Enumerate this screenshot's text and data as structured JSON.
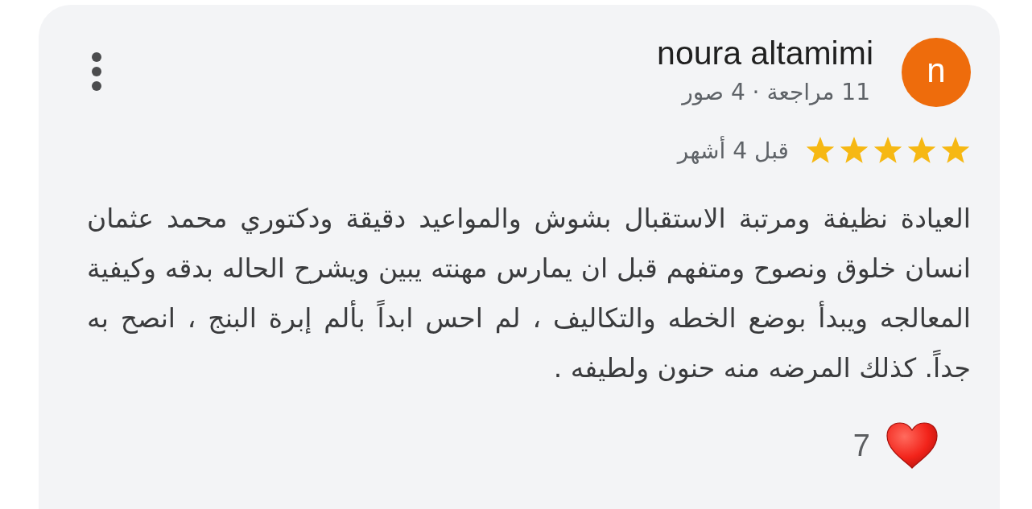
{
  "review": {
    "author": {
      "name": "noura altamimi",
      "initial": "n"
    },
    "meta": "11 مراجعة · 4 صور",
    "stars": 5,
    "time": "قبل 4 أشهر",
    "text": "العيادة نظيفة ومرتبة الاستقبال بشوش والمواعيد دقيقة ودكتوري محمد عثمان انسان خلوق ونصوح ومتفهم قبل ان يمارس مهنته يبين ويشرح الحاله بدقه وكيفية المعالجه ويبدأ بوضع الخطه والتكاليف ، لم احس ابداً بألم إبرة البنج ، انصح به جداً. كذلك المرضه منه حنون ولطيفه .",
    "reactions": [
      {
        "kind": "heart",
        "count": "7"
      }
    ]
  }
}
